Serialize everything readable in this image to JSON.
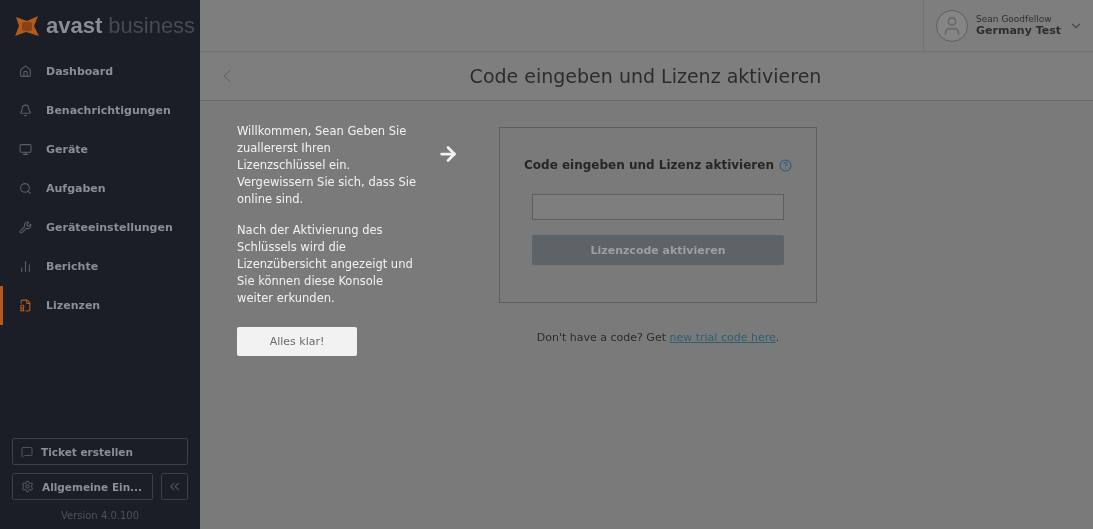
{
  "sidebar": {
    "logo": {
      "word": "avast",
      "suffix": "business"
    },
    "items": [
      {
        "label": "Dashboard",
        "selected": false
      },
      {
        "label": "Benachrichtigungen",
        "selected": false
      },
      {
        "label": "Geräte",
        "selected": false
      },
      {
        "label": "Aufgaben",
        "selected": false
      },
      {
        "label": "Geräteeinstellungen",
        "selected": false
      },
      {
        "label": "Berichte",
        "selected": false
      },
      {
        "label": "Lizenzen",
        "selected": true
      }
    ],
    "ticket_button": "Ticket erstellen",
    "settings_button": "Allgemeine Ein...",
    "version": "Version 4.0.100"
  },
  "user": {
    "name": "Sean Goodfellow",
    "company": "Germany Test"
  },
  "page_title": "Code eingeben und Lizenz aktivieren",
  "welcome": {
    "paragraphs": [
      "Willkommen, Sean Geben Sie zuallererst Ihren Lizenzschlüssel ein. Vergewissern Sie sich, dass Sie online sind.",
      "Nach der Aktivierung des Schlüssels wird die Lizenzübersicht angezeigt und Sie können diese Konsole weiter erkunden."
    ],
    "button": "Alles klar!"
  },
  "activation": {
    "heading": "Code eingeben und Lizenz aktivieren",
    "button": "Lizenzcode aktivieren",
    "button_disabled": true
  },
  "trial": {
    "prefix": "Don't have a code? Get ",
    "link": "new trial code here",
    "suffix": "."
  }
}
